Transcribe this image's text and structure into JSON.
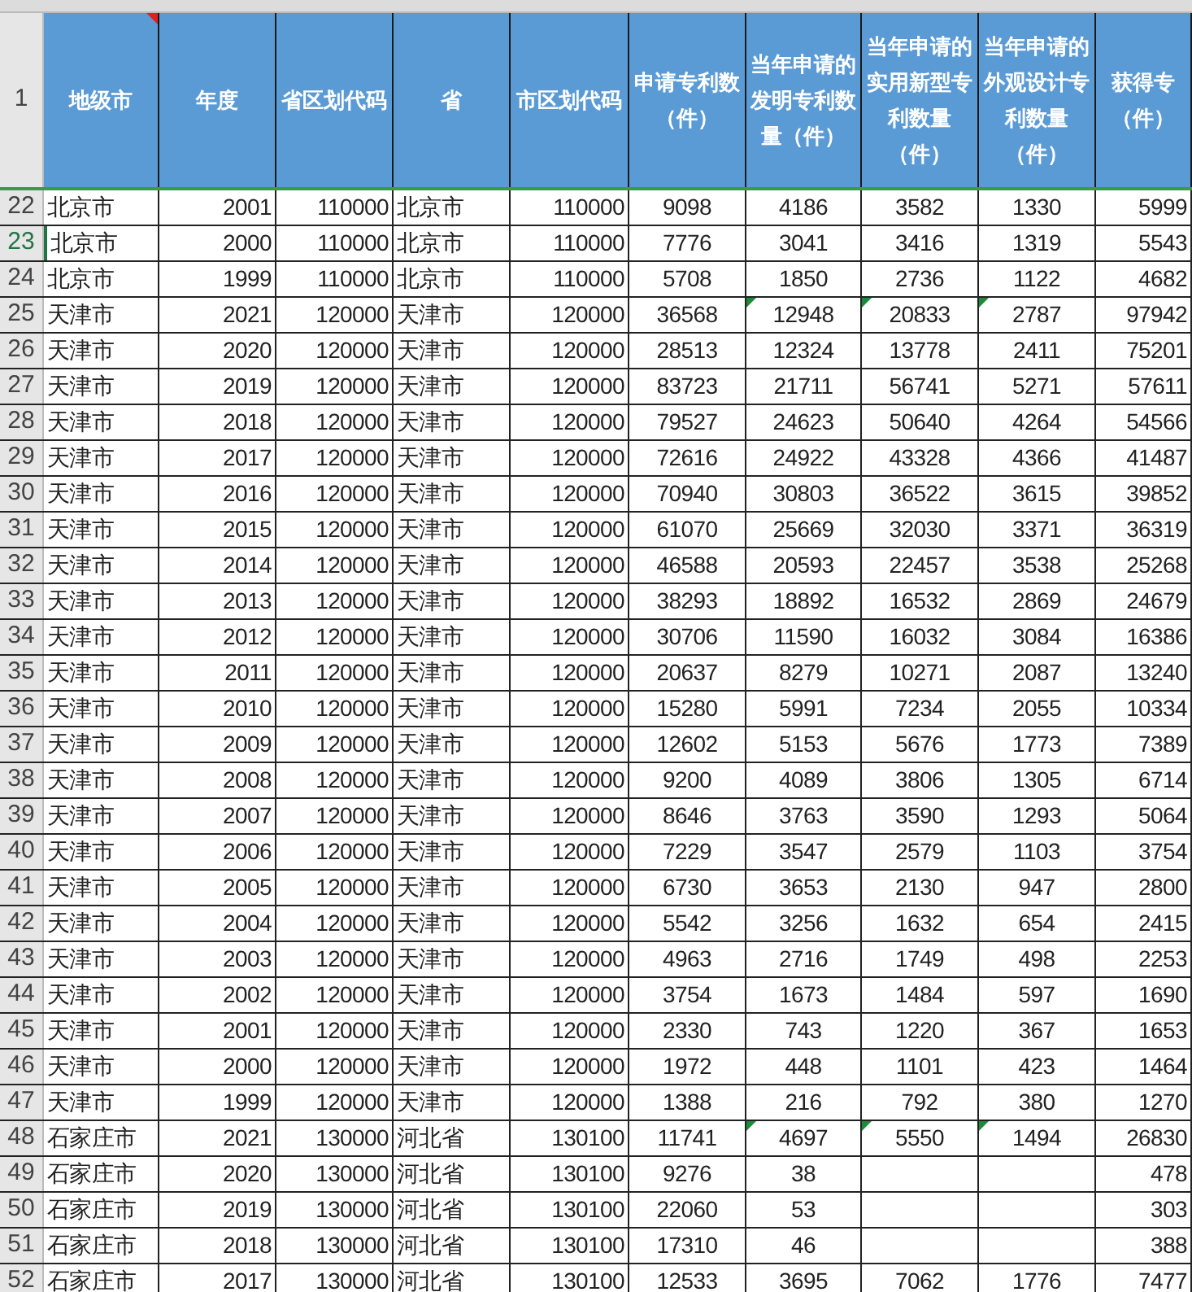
{
  "header": {
    "row_number": "1",
    "comment_marker": true,
    "columns": [
      "地级市",
      "年度",
      "省区划代码",
      "省",
      "市区划代码",
      "申请专利数（件）",
      "当年申请的发明专利数量（件）",
      "当年申请的实用新型专利数量（件）",
      "当年申请的外观设计专利数量（件）",
      "获得专（件）"
    ]
  },
  "rows": [
    {
      "num": "22",
      "active": false,
      "flagged": false,
      "cells": [
        "北京市",
        "2001",
        "110000",
        "北京市",
        "110000",
        "9098",
        "4186",
        "3582",
        "1330",
        "5999"
      ]
    },
    {
      "num": "23",
      "active": true,
      "flagged": false,
      "cells": [
        "北京市",
        "2000",
        "110000",
        "北京市",
        "110000",
        "7776",
        "3041",
        "3416",
        "1319",
        "5543"
      ]
    },
    {
      "num": "24",
      "active": false,
      "flagged": false,
      "cells": [
        "北京市",
        "1999",
        "110000",
        "北京市",
        "110000",
        "5708",
        "1850",
        "2736",
        "1122",
        "4682"
      ]
    },
    {
      "num": "25",
      "active": false,
      "flagged": true,
      "cells": [
        "天津市",
        "2021",
        "120000",
        "天津市",
        "120000",
        "36568",
        "12948",
        "20833",
        "2787",
        "97942"
      ]
    },
    {
      "num": "26",
      "active": false,
      "flagged": false,
      "cells": [
        "天津市",
        "2020",
        "120000",
        "天津市",
        "120000",
        "28513",
        "12324",
        "13778",
        "2411",
        "75201"
      ]
    },
    {
      "num": "27",
      "active": false,
      "flagged": false,
      "cells": [
        "天津市",
        "2019",
        "120000",
        "天津市",
        "120000",
        "83723",
        "21711",
        "56741",
        "5271",
        "57611"
      ]
    },
    {
      "num": "28",
      "active": false,
      "flagged": false,
      "cells": [
        "天津市",
        "2018",
        "120000",
        "天津市",
        "120000",
        "79527",
        "24623",
        "50640",
        "4264",
        "54566"
      ]
    },
    {
      "num": "29",
      "active": false,
      "flagged": false,
      "cells": [
        "天津市",
        "2017",
        "120000",
        "天津市",
        "120000",
        "72616",
        "24922",
        "43328",
        "4366",
        "41487"
      ]
    },
    {
      "num": "30",
      "active": false,
      "flagged": false,
      "cells": [
        "天津市",
        "2016",
        "120000",
        "天津市",
        "120000",
        "70940",
        "30803",
        "36522",
        "3615",
        "39852"
      ]
    },
    {
      "num": "31",
      "active": false,
      "flagged": false,
      "cells": [
        "天津市",
        "2015",
        "120000",
        "天津市",
        "120000",
        "61070",
        "25669",
        "32030",
        "3371",
        "36319"
      ]
    },
    {
      "num": "32",
      "active": false,
      "flagged": false,
      "cells": [
        "天津市",
        "2014",
        "120000",
        "天津市",
        "120000",
        "46588",
        "20593",
        "22457",
        "3538",
        "25268"
      ]
    },
    {
      "num": "33",
      "active": false,
      "flagged": false,
      "cells": [
        "天津市",
        "2013",
        "120000",
        "天津市",
        "120000",
        "38293",
        "18892",
        "16532",
        "2869",
        "24679"
      ]
    },
    {
      "num": "34",
      "active": false,
      "flagged": false,
      "cells": [
        "天津市",
        "2012",
        "120000",
        "天津市",
        "120000",
        "30706",
        "11590",
        "16032",
        "3084",
        "16386"
      ]
    },
    {
      "num": "35",
      "active": false,
      "flagged": false,
      "cells": [
        "天津市",
        "2011",
        "120000",
        "天津市",
        "120000",
        "20637",
        "8279",
        "10271",
        "2087",
        "13240"
      ]
    },
    {
      "num": "36",
      "active": false,
      "flagged": false,
      "cells": [
        "天津市",
        "2010",
        "120000",
        "天津市",
        "120000",
        "15280",
        "5991",
        "7234",
        "2055",
        "10334"
      ]
    },
    {
      "num": "37",
      "active": false,
      "flagged": false,
      "cells": [
        "天津市",
        "2009",
        "120000",
        "天津市",
        "120000",
        "12602",
        "5153",
        "5676",
        "1773",
        "7389"
      ]
    },
    {
      "num": "38",
      "active": false,
      "flagged": false,
      "cells": [
        "天津市",
        "2008",
        "120000",
        "天津市",
        "120000",
        "9200",
        "4089",
        "3806",
        "1305",
        "6714"
      ]
    },
    {
      "num": "39",
      "active": false,
      "flagged": false,
      "cells": [
        "天津市",
        "2007",
        "120000",
        "天津市",
        "120000",
        "8646",
        "3763",
        "3590",
        "1293",
        "5064"
      ]
    },
    {
      "num": "40",
      "active": false,
      "flagged": false,
      "cells": [
        "天津市",
        "2006",
        "120000",
        "天津市",
        "120000",
        "7229",
        "3547",
        "2579",
        "1103",
        "3754"
      ]
    },
    {
      "num": "41",
      "active": false,
      "flagged": false,
      "cells": [
        "天津市",
        "2005",
        "120000",
        "天津市",
        "120000",
        "6730",
        "3653",
        "2130",
        "947",
        "2800"
      ]
    },
    {
      "num": "42",
      "active": false,
      "flagged": false,
      "cells": [
        "天津市",
        "2004",
        "120000",
        "天津市",
        "120000",
        "5542",
        "3256",
        "1632",
        "654",
        "2415"
      ]
    },
    {
      "num": "43",
      "active": false,
      "flagged": false,
      "cells": [
        "天津市",
        "2003",
        "120000",
        "天津市",
        "120000",
        "4963",
        "2716",
        "1749",
        "498",
        "2253"
      ]
    },
    {
      "num": "44",
      "active": false,
      "flagged": false,
      "cells": [
        "天津市",
        "2002",
        "120000",
        "天津市",
        "120000",
        "3754",
        "1673",
        "1484",
        "597",
        "1690"
      ]
    },
    {
      "num": "45",
      "active": false,
      "flagged": false,
      "cells": [
        "天津市",
        "2001",
        "120000",
        "天津市",
        "120000",
        "2330",
        "743",
        "1220",
        "367",
        "1653"
      ]
    },
    {
      "num": "46",
      "active": false,
      "flagged": false,
      "cells": [
        "天津市",
        "2000",
        "120000",
        "天津市",
        "120000",
        "1972",
        "448",
        "1101",
        "423",
        "1464"
      ]
    },
    {
      "num": "47",
      "active": false,
      "flagged": false,
      "cells": [
        "天津市",
        "1999",
        "120000",
        "天津市",
        "120000",
        "1388",
        "216",
        "792",
        "380",
        "1270"
      ]
    },
    {
      "num": "48",
      "active": false,
      "flagged": true,
      "cells": [
        "石家庄市",
        "2021",
        "130000",
        "河北省",
        "130100",
        "11741",
        "4697",
        "5550",
        "1494",
        "26830"
      ]
    },
    {
      "num": "49",
      "active": false,
      "flagged": false,
      "cells": [
        "石家庄市",
        "2020",
        "130000",
        "河北省",
        "130100",
        "9276",
        "38",
        null,
        null,
        "478"
      ]
    },
    {
      "num": "50",
      "active": false,
      "flagged": false,
      "cells": [
        "石家庄市",
        "2019",
        "130000",
        "河北省",
        "130100",
        "22060",
        "53",
        null,
        null,
        "303"
      ]
    },
    {
      "num": "51",
      "active": false,
      "flagged": false,
      "cells": [
        "石家庄市",
        "2018",
        "130000",
        "河北省",
        "130100",
        "17310",
        "46",
        null,
        null,
        "388"
      ]
    },
    {
      "num": "52",
      "active": false,
      "flagged": false,
      "cells": [
        "石家庄市",
        "2017",
        "130000",
        "河北省",
        "130100",
        "12533",
        "3695",
        "7062",
        "1776",
        "7477"
      ]
    }
  ]
}
